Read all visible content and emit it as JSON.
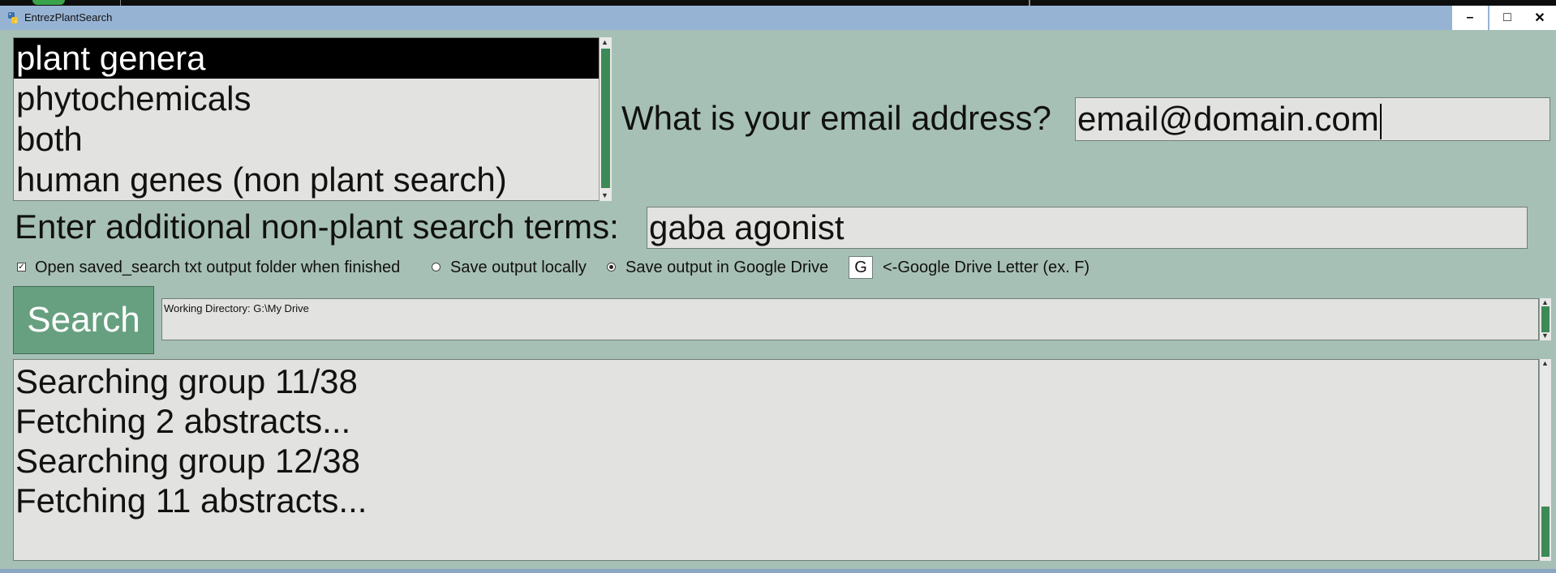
{
  "window": {
    "title": "EntrezPlantSearch",
    "minimize_glyph": "–",
    "maximize_glyph": "□",
    "close_glyph": "✕"
  },
  "search_type_list": {
    "items": [
      {
        "label": "plant genera",
        "selected": true
      },
      {
        "label": "phytochemicals",
        "selected": false
      },
      {
        "label": "both",
        "selected": false
      },
      {
        "label": "human genes (non plant search)",
        "selected": false
      }
    ]
  },
  "email": {
    "label": "What is your email address?",
    "value": "email@domain.com"
  },
  "terms": {
    "label": "Enter additional non-plant search terms:",
    "value": "gaba agonist"
  },
  "options": {
    "open_folder_label": "Open saved_search txt output folder when finished",
    "open_folder_checked": true,
    "save_local_label": "Save output locally",
    "save_local_selected": false,
    "save_drive_label": "Save output in Google Drive",
    "save_drive_selected": true,
    "drive_letter_value": "G",
    "drive_letter_hint": "<-Google Drive Letter (ex. F)"
  },
  "search_button": {
    "label": "Search"
  },
  "working_directory": {
    "text": "Working Directory: G:\\My Drive"
  },
  "output": {
    "lines": [
      "Searching group 11/38",
      "Fetching 2 abstracts...",
      "Searching group 12/38",
      "Fetching 11 abstracts..."
    ]
  },
  "colors": {
    "window_background": "#a7c0b5",
    "titlebar": "#97b3d4",
    "search_button": "#67a080",
    "scroll_thumb": "#3d8a57",
    "field_background": "#e2e2e0"
  },
  "icons": {
    "app": "python-icon",
    "check": "checkmark-icon"
  }
}
